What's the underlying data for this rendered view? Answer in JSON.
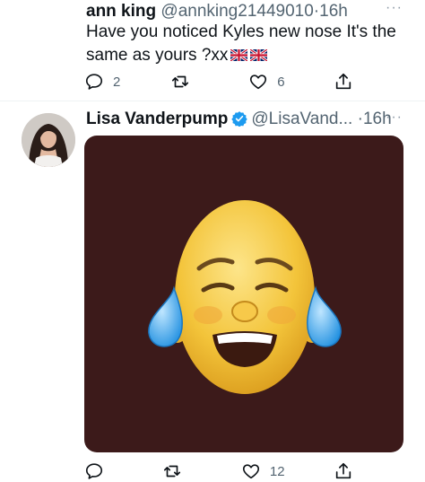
{
  "tweets": [
    {
      "author_name": "ann king",
      "handle": "@annking21449010",
      "dot": "·",
      "time": "16h",
      "text": "Have you noticed Kyles new nose It's the same as yours ?xx",
      "flags": [
        "uk-flag-emoji",
        "uk-flag-emoji"
      ],
      "replies": "2",
      "retweets": "",
      "likes": "6"
    },
    {
      "author_name": "Lisa Vanderpump",
      "verified": true,
      "handle": "@LisaVand...",
      "dot": "·",
      "time": "16h",
      "media": "crying-laughing-memoji",
      "replies": "",
      "retweets": "",
      "likes": "12"
    }
  ],
  "icons": {
    "reply": "reply-icon",
    "retweet": "retweet-icon",
    "like": "heart-icon",
    "share": "share-icon",
    "more": "more-icon"
  },
  "colors": {
    "verified_badge": "#1d9bf0",
    "media_background": "#3c1a1a",
    "muted_text": "#536471"
  }
}
